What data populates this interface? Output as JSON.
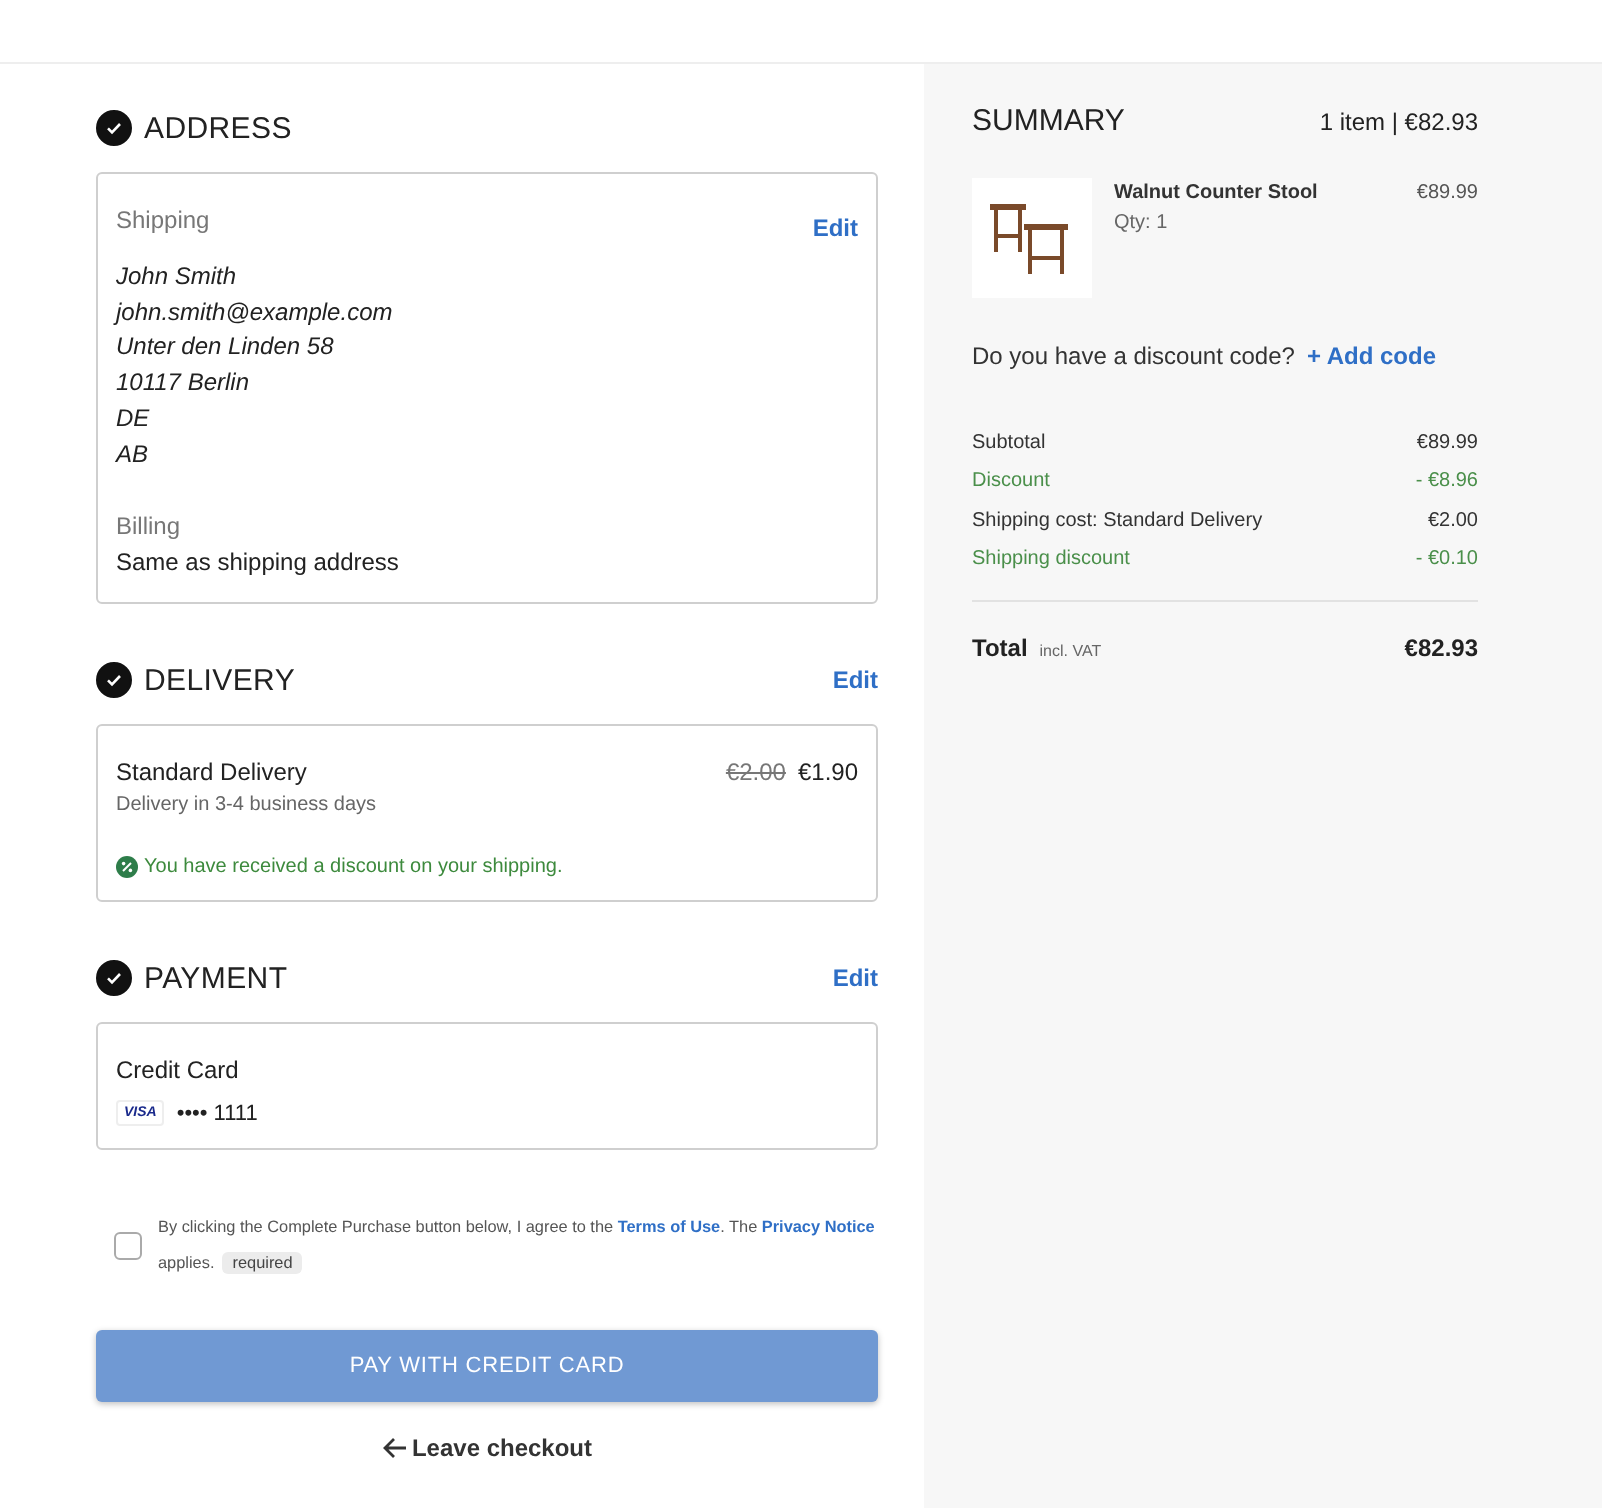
{
  "address": {
    "title": "ADDRESS",
    "completed": true,
    "edit": "Edit",
    "shipping_label": "Shipping",
    "shipping_lines": [
      "John Smith",
      "john.smith@example.com",
      "Unter den Linden 58",
      "10117 Berlin",
      "DE",
      "AB"
    ],
    "billing_label": "Billing",
    "billing_value": "Same as shipping address"
  },
  "delivery": {
    "title": "DELIVERY",
    "completed": true,
    "edit": "Edit",
    "method": "Standard Delivery",
    "eta": "Delivery in 3-4 business days",
    "old_price": "€2.00",
    "price": "€1.90",
    "notice": "You have received a discount on your shipping."
  },
  "payment": {
    "title": "PAYMENT",
    "completed": true,
    "edit": "Edit",
    "method": "Credit Card",
    "card_brand": "VISA",
    "card_number": "•••• 1111"
  },
  "consent": {
    "checked": false,
    "text_before": "By clicking the Complete Purchase button below, I agree to the",
    "terms_link": "Terms of Use",
    "text_middle": ". The",
    "privacy_link": "Privacy Notice",
    "text_after": "applies.",
    "badge": "required"
  },
  "pay_button": {
    "label": "PAY WITH CREDIT CARD",
    "disabled": true
  },
  "leave_link": "Leave checkout",
  "summary": {
    "title": "SUMMARY",
    "count": "1 item | €82.93",
    "items": [
      {
        "name": "Walnut Counter Stool",
        "qty": "Qty: 1",
        "price": "€89.99"
      }
    ],
    "discount_prompt": "Do you have a discount code?",
    "add_code": "+ Add code",
    "lines": [
      {
        "label": "Subtotal",
        "value": "€89.99",
        "kind": "normal"
      },
      {
        "label": "Discount",
        "value": "- €8.96",
        "kind": "discount"
      },
      {
        "label": "Shipping cost: Standard Delivery",
        "value": "€2.00",
        "kind": "normal"
      },
      {
        "label": "Shipping discount",
        "value": "- €0.10",
        "kind": "discount"
      }
    ],
    "total": {
      "label": "Total",
      "note": "incl. VAT",
      "value": "€82.93"
    }
  }
}
